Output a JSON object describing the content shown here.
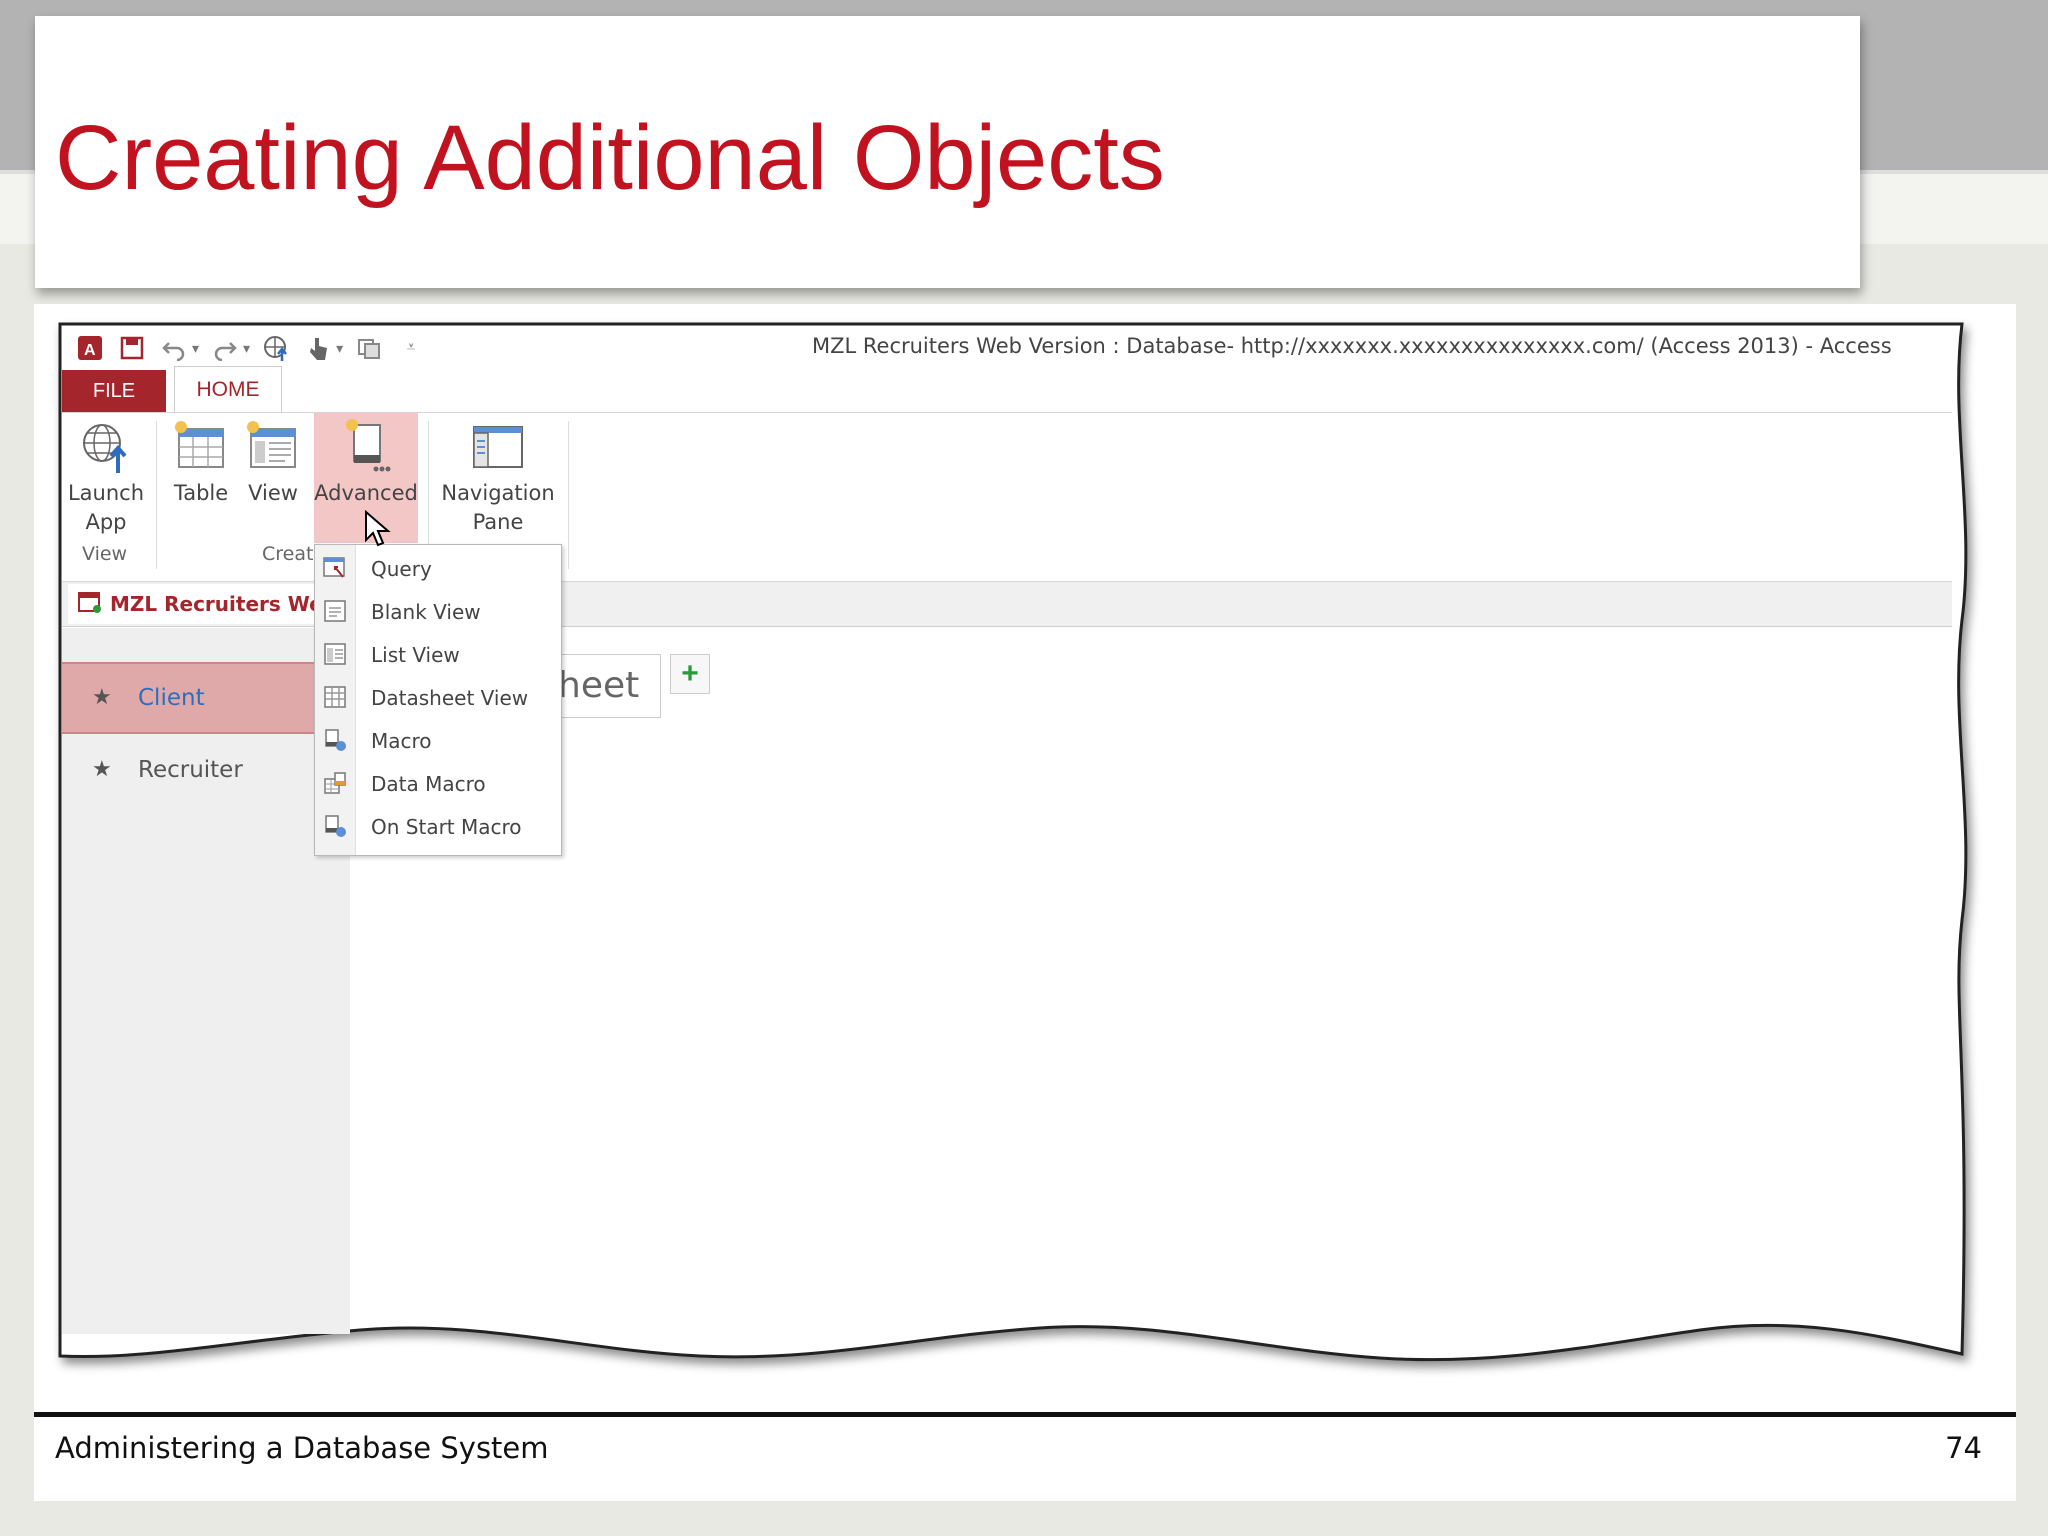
{
  "slide": {
    "title": "Creating Additional Objects",
    "footer_left": "Administering a Database System",
    "page_number": "74"
  },
  "window": {
    "title": "MZL Recruiters Web Version : Database- http://xxxxxxx.xxxxxxxxxxxxxxx.com/ (Access 2013) - Access",
    "quick_access_icons": [
      "access-logo-icon",
      "save-icon",
      "undo-icon",
      "redo-icon",
      "launch-app-icon",
      "touch-mode-icon",
      "sync-icon",
      "customize-qat-icon"
    ]
  },
  "ribbon": {
    "tabs": [
      {
        "label": "FILE"
      },
      {
        "label": "HOME"
      }
    ],
    "buttons": {
      "launch_app_line1": "Launch",
      "launch_app_line2": "App",
      "table": "Table",
      "view": "View",
      "advanced": "Advanced",
      "navigation_pane_line1": "Navigation",
      "navigation_pane_line2": "Pane"
    },
    "groups": {
      "view": "View",
      "create": "Creat"
    },
    "active_color": "#f4c7c7",
    "accent_color": "#a4262c"
  },
  "document_tab": {
    "label": "MZL Recruiters Web V"
  },
  "navigation": {
    "items": [
      {
        "label": "Client",
        "selected": true
      },
      {
        "label": "Recruiter",
        "selected": false
      }
    ]
  },
  "content": {
    "view_tab_partial": "heet",
    "add_view_symbol": "+"
  },
  "advanced_menu": {
    "items": [
      {
        "label": "Query",
        "icon": "query-icon"
      },
      {
        "label": "Blank View",
        "icon": "blank-view-icon"
      },
      {
        "label": "List View",
        "icon": "list-view-icon"
      },
      {
        "label": "Datasheet View",
        "icon": "datasheet-view-icon"
      },
      {
        "label": "Macro",
        "icon": "macro-icon"
      },
      {
        "label": "Data Macro",
        "icon": "data-macro-icon"
      },
      {
        "label": "On Start Macro",
        "icon": "on-start-macro-icon"
      }
    ]
  }
}
